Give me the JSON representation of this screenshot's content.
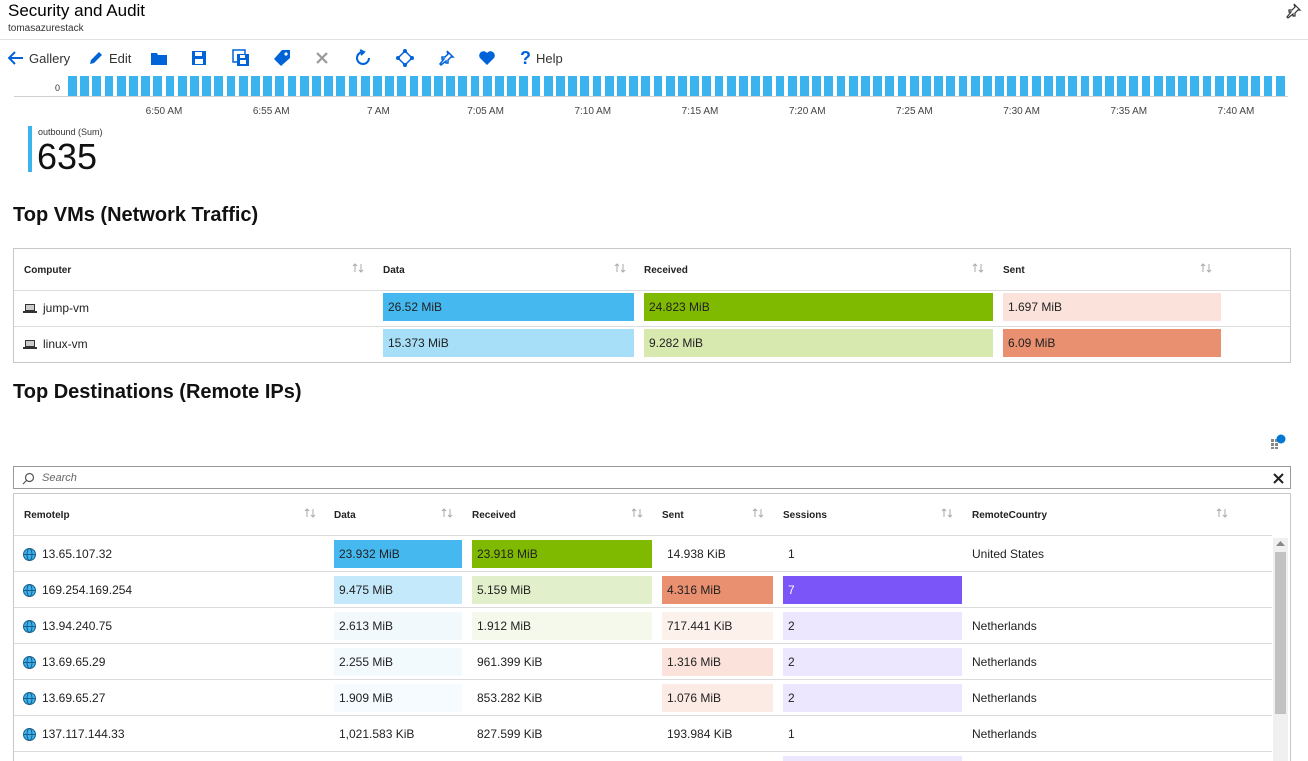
{
  "header": {
    "title": "Security and Audit",
    "subtitle": "tomasazurestack"
  },
  "toolbar": {
    "gallery_label": "Gallery",
    "edit_label": "Edit",
    "help_label": "Help"
  },
  "timeline": {
    "zero_label": "0",
    "ticks": [
      "6:50 AM",
      "6:55 AM",
      "7 AM",
      "7:05 AM",
      "7:10 AM",
      "7:15 AM",
      "7:20 AM",
      "7:25 AM",
      "7:30 AM",
      "7:35 AM",
      "7:40 AM"
    ]
  },
  "metric": {
    "label": "outbound (Sum)",
    "value": "635"
  },
  "vms": {
    "title": "Top VMs (Network Traffic)",
    "columns": [
      "Computer",
      "Data",
      "Received",
      "Sent"
    ],
    "rows": [
      {
        "computer": "jump-vm",
        "data": "26.52 MiB",
        "received": "24.823 MiB",
        "sent": "1.697 MiB"
      },
      {
        "computer": "linux-vm",
        "data": "15.373 MiB",
        "received": "9.282 MiB",
        "sent": "6.09 MiB"
      }
    ]
  },
  "destinations": {
    "title": "Top Destinations (Remote IPs)",
    "search_placeholder": "Search",
    "columns": [
      "RemoteIp",
      "Data",
      "Received",
      "Sent",
      "Sessions",
      "RemoteCountry"
    ],
    "rows": [
      {
        "ip": "13.65.107.32",
        "data": "23.932 MiB",
        "received": "23.918 MiB",
        "sent": "14.938 KiB",
        "sessions": "1",
        "country": "United States"
      },
      {
        "ip": "169.254.169.254",
        "data": "9.475 MiB",
        "received": "5.159 MiB",
        "sent": "4.316 MiB",
        "sessions": "7",
        "country": ""
      },
      {
        "ip": "13.94.240.75",
        "data": "2.613 MiB",
        "received": "1.912 MiB",
        "sent": "717.441 KiB",
        "sessions": "2",
        "country": "Netherlands"
      },
      {
        "ip": "13.69.65.29",
        "data": "2.255 MiB",
        "received": "961.399 KiB",
        "sent": "1.316 MiB",
        "sessions": "2",
        "country": "Netherlands"
      },
      {
        "ip": "13.69.65.27",
        "data": "1.909 MiB",
        "received": "853.282 KiB",
        "sent": "1.076 MiB",
        "sessions": "2",
        "country": "Netherlands"
      },
      {
        "ip": "137.117.144.33",
        "data": "1,021.583 KiB",
        "received": "827.599 KiB",
        "sent": "193.984 KiB",
        "sessions": "1",
        "country": "Netherlands"
      }
    ]
  },
  "colors": {
    "accent": "#0063d8",
    "data_blue": "#3bb3ef",
    "received_green": "#7fba00",
    "sent_salmon": "#e8906f",
    "sessions_purple": "#7b55f8"
  }
}
